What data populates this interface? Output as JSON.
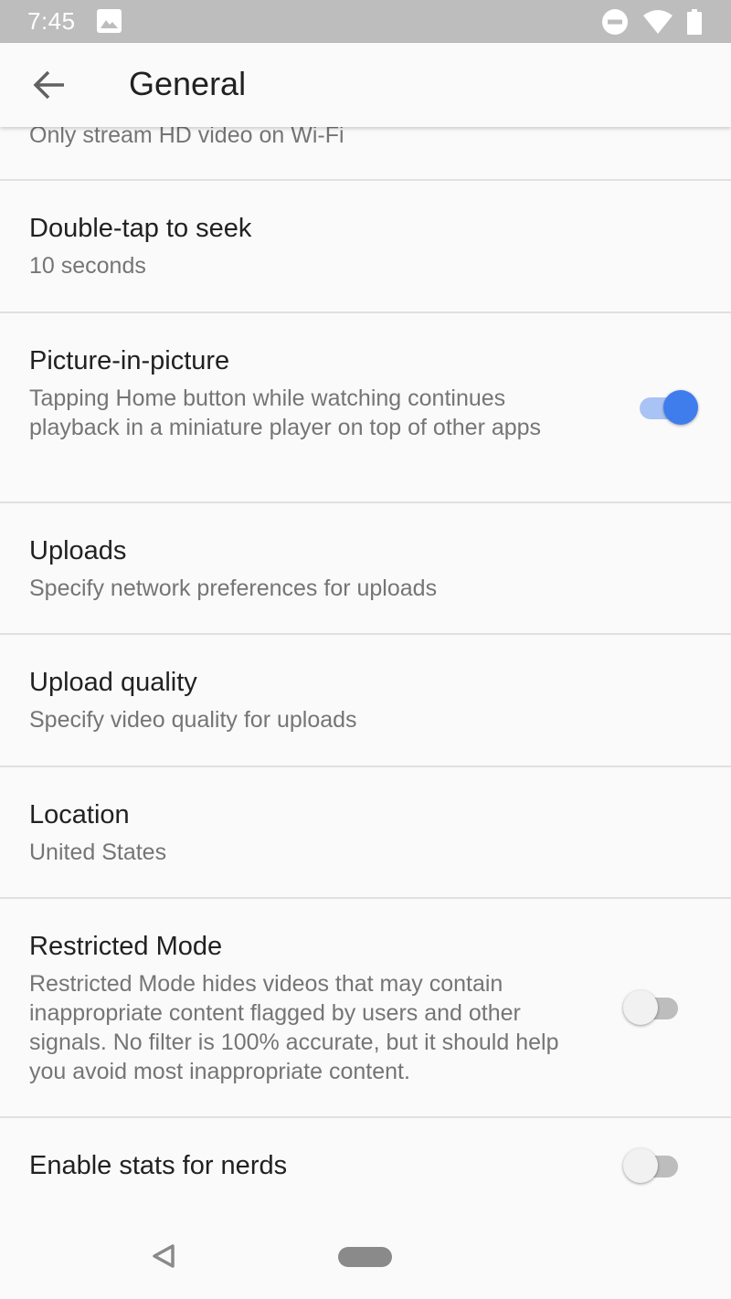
{
  "status_bar": {
    "time": "7:45",
    "icons": [
      "image-icon",
      "do-not-disturb-icon",
      "wifi-icon",
      "battery-icon"
    ]
  },
  "app_bar": {
    "back_icon": "arrow-back-icon",
    "title": "General"
  },
  "settings": [
    {
      "key": "hd_wifi",
      "title": "",
      "description": "Only stream HD video on Wi-Fi",
      "toggle": true
    },
    {
      "key": "double_tap",
      "title": "Double-tap to seek",
      "description": "10 seconds"
    },
    {
      "key": "pip",
      "title": "Picture-in-picture",
      "description": "Tapping Home button while watching continues playback in a miniature player on top of other apps",
      "toggle": true
    },
    {
      "key": "uploads",
      "title": "Uploads",
      "description": "Specify network preferences for uploads"
    },
    {
      "key": "upload_quality",
      "title": "Upload quality",
      "description": "Specify video quality for uploads"
    },
    {
      "key": "location",
      "title": "Location",
      "description": "United States"
    },
    {
      "key": "restricted",
      "title": "Restricted Mode",
      "description": "Restricted Mode hides videos that may contain inappropriate content flagged by users and other signals. No filter is 100% accurate, but it should help you avoid most inappropriate content.",
      "toggle": false
    },
    {
      "key": "stats",
      "title": "Enable stats for nerds",
      "description": "",
      "toggle": false
    }
  ],
  "colors": {
    "accent": "#3f7ded",
    "accent_track": "#aac3f5",
    "status_bar": "#bdbdbd",
    "divider": "#e0e0e0"
  },
  "nav_bar": {
    "icons": [
      "nav-back-icon",
      "home-pill-icon"
    ]
  }
}
